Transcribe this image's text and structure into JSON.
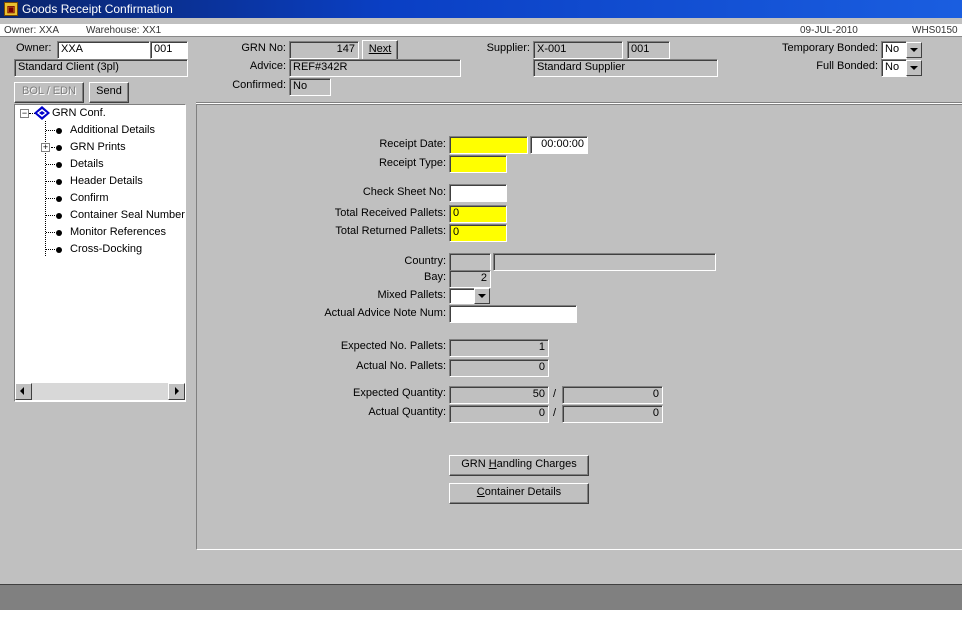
{
  "window": {
    "title": "Goods Receipt Confirmation",
    "app_icon": "oracle-forms-icon"
  },
  "infobar": {
    "owner_text": "Owner: XXA",
    "warehouse_text": "Warehouse: XX1",
    "date": "09-JUL-2010",
    "code": "WHS0150"
  },
  "header": {
    "owner_label": "Owner:",
    "owner_value": "XXA",
    "owner_code": "001",
    "owner_name": "Standard Client (3pl)",
    "bol_button": "BOL / EDN",
    "send_button": "Send",
    "grn_no_label": "GRN No:",
    "grn_no_value": "147",
    "next_button": "Next",
    "advice_label": "Advice:",
    "advice_value": "REF#342R",
    "confirmed_label": "Confirmed:",
    "confirmed_value": "No",
    "supplier_label": "Supplier:",
    "supplier_value": "X-001",
    "supplier_code": "001",
    "supplier_name": "Standard Supplier",
    "temp_bonded_label": "Temporary Bonded:",
    "temp_bonded_value": "No",
    "full_bonded_label": "Full Bonded:",
    "full_bonded_value": "No"
  },
  "tree": {
    "root": "GRN Conf.",
    "items": [
      "Additional Details",
      "GRN Prints",
      "Details",
      "Header Details",
      "Confirm",
      "Container Seal Numbers",
      "Monitor References",
      "Cross-Docking"
    ]
  },
  "form": {
    "receipt_date_label": "Receipt Date:",
    "receipt_date_value": "",
    "receipt_time_value": "00:00:00",
    "receipt_type_label": "Receipt Type:",
    "receipt_type_value": "",
    "check_sheet_label": "Check Sheet No:",
    "check_sheet_value": "",
    "total_received_label": "Total Received Pallets:",
    "total_received_value": "0",
    "total_returned_label": "Total Returned Pallets:",
    "total_returned_value": "0",
    "country_label": "Country:",
    "country_code": "",
    "country_name": "",
    "bay_label": "Bay:",
    "bay_value": "2",
    "mixed_pallets_label": "Mixed Pallets:",
    "mixed_pallets_value": "",
    "actual_advice_label": "Actual Advice Note Num:",
    "actual_advice_value": "",
    "expected_pallets_label": "Expected No. Pallets:",
    "expected_pallets_value": "1",
    "actual_pallets_label": "Actual No. Pallets:",
    "actual_pallets_value": "0",
    "expected_qty_label": "Expected Quantity:",
    "expected_qty_value": "50",
    "expected_qty_value2": "0",
    "actual_qty_label": "Actual Quantity:",
    "actual_qty_value": "0",
    "actual_qty_value2": "0",
    "slash": "/",
    "grn_handling_prefix": "GRN ",
    "grn_handling_hotkey": "H",
    "grn_handling_rest": "andling Charges",
    "container_hotkey": "C",
    "container_rest": "ontainer Details"
  },
  "colors": {
    "window_bg": "#c0c0c0",
    "required_field": "#ffff00",
    "titlebar": "#0a246a"
  }
}
